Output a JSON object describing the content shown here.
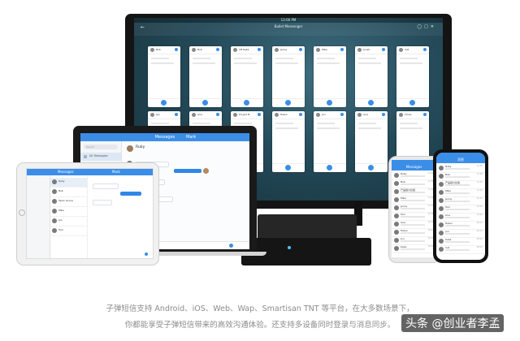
{
  "monitor": {
    "status_time": "12:00 PM",
    "header_title": "Bullet Messenger",
    "cards": [
      {
        "name": "Bob"
      },
      {
        "name": "Bob"
      },
      {
        "name": "CB Kaka"
      },
      {
        "name": "Jenny"
      },
      {
        "name": "Mike"
      },
      {
        "name": "Jonah"
      },
      {
        "name": "Cat"
      },
      {
        "name": "Jan"
      },
      {
        "name": "Ana"
      },
      {
        "name": "Project B"
      },
      {
        "name": "Helen"
      },
      {
        "name": "Jon"
      },
      {
        "name": "Ana"
      },
      {
        "name": "Chloe"
      }
    ]
  },
  "laptop": {
    "header_title": "Messages",
    "header_right": "Mark",
    "search_placeholder": "Search",
    "sidebar_items": [
      "All Messages",
      "Unread",
      "Groups",
      "Favorites",
      "Archived"
    ],
    "chat_name": "Ruby"
  },
  "ipad": {
    "header_title": "Messages",
    "header_right": "Mark",
    "contacts": [
      "Ruby",
      "Bob",
      "Open Group",
      "Mike",
      "Jan",
      "Tom"
    ]
  },
  "phone_left": {
    "title": "Messages",
    "rows": [
      {
        "name": "Ruby",
        "time": "12:00"
      },
      {
        "name": "Bob",
        "time": "11:58"
      },
      {
        "name": "产品组讨论组",
        "time": "11:40"
      },
      {
        "name": "Mike",
        "time": "11:20"
      },
      {
        "name": "Jenny",
        "time": "10:55"
      },
      {
        "name": "Tom",
        "time": "10:30"
      },
      {
        "name": "Ana",
        "time": "10:02"
      },
      {
        "name": "Helen",
        "time": "09:47"
      },
      {
        "name": "Jon",
        "time": "09:12"
      },
      {
        "name": "Kaka",
        "time": "08:40"
      }
    ]
  },
  "phone_right": {
    "title": "消息",
    "rows": [
      {
        "name": "Ruby",
        "time": "12:00"
      },
      {
        "name": "Bob",
        "time": "11:58"
      },
      {
        "name": "产品组讨论组",
        "time": "11:40"
      },
      {
        "name": "Mike",
        "time": "11:20"
      },
      {
        "name": "Jenny",
        "time": "10:55"
      },
      {
        "name": "Tom",
        "time": "10:30"
      },
      {
        "name": "Ana",
        "time": "10:02"
      },
      {
        "name": "Helen",
        "time": "09:47"
      },
      {
        "name": "Jon",
        "time": "09:12"
      },
      {
        "name": "Kaka",
        "time": "08:40"
      },
      {
        "name": "Cat",
        "time": "08:10"
      }
    ]
  },
  "caption": {
    "line1": "子弹短信支持 Android、iOS、Web、Wap、Smartisan TNT 等平台，在大多数场景下，",
    "line2": "你都能享受子弹短信带来的高效沟通体验。还支持多设备同时登录与消息同步。"
  },
  "watermark": "头条 @创业者李孟",
  "colors": {
    "accent": "#3b8ee8",
    "monitor_bg": "#254b5a",
    "caption_text": "#8c8c8c"
  }
}
